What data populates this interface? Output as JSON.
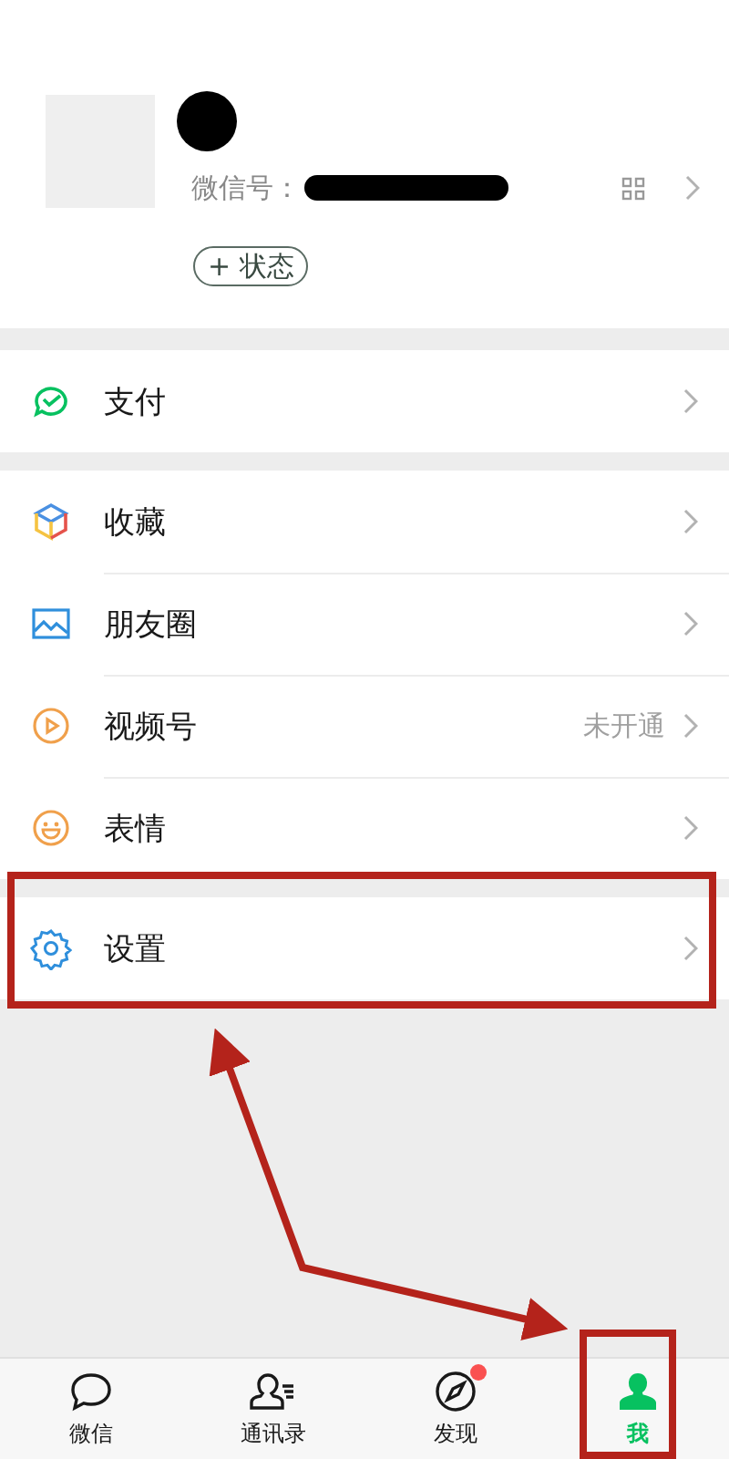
{
  "profile": {
    "id_label": "微信号：",
    "status_button": "+ 状态"
  },
  "menu_groups": [
    [
      {
        "kind": "pay",
        "label": "支付"
      }
    ],
    [
      {
        "kind": "favorites",
        "label": "收藏"
      },
      {
        "kind": "moments",
        "label": "朋友圈"
      },
      {
        "kind": "channels",
        "label": "视频号",
        "value": "未开通"
      },
      {
        "kind": "stickers",
        "label": "表情"
      }
    ],
    [
      {
        "kind": "settings",
        "label": "设置"
      }
    ]
  ],
  "tabs": [
    {
      "kind": "chats",
      "label": "微信",
      "selected": false,
      "badge": false
    },
    {
      "kind": "contacts",
      "label": "通讯录",
      "selected": false,
      "badge": false
    },
    {
      "kind": "discover",
      "label": "发现",
      "selected": false,
      "badge": true
    },
    {
      "kind": "me",
      "label": "我",
      "selected": true,
      "badge": false
    }
  ],
  "annotations": [
    {
      "kind": "row-box"
    },
    {
      "kind": "tab-box"
    },
    {
      "kind": "arrow"
    }
  ]
}
